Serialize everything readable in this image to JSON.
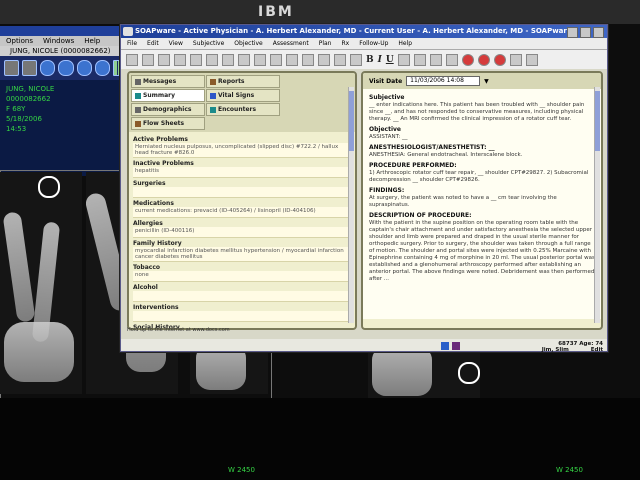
{
  "monitor": {
    "brand": "IBM"
  },
  "viewer": {
    "title": "",
    "menu": [
      "Options",
      "Windows",
      "Help"
    ],
    "patient": "JUNG, NICOLE (0000082662)",
    "meta_lines": [
      "JUNG, NICOLE",
      "0000082662",
      "F 68Y",
      "5/18/2006",
      "14:53"
    ],
    "footer_left": "W 2450",
    "footer_right": "W 2450"
  },
  "app": {
    "title": "SOAPware - Active Physician - A. Herbert Alexander, MD - Current User - A. Herbert Alexander, MD - SOAPware",
    "menu": [
      "File",
      "Edit",
      "View",
      "Subjective",
      "Objective",
      "Assessment",
      "Plan",
      "Rx",
      "Follow-Up",
      "Help"
    ],
    "toolbar_labels": {
      "bold": "B",
      "italic": "I",
      "underline": "U"
    },
    "tabs": [
      {
        "label": "Messages",
        "icon": "envelope-icon"
      },
      {
        "label": "Reports",
        "icon": "report-icon"
      },
      {
        "label": "Summary",
        "icon": "summary-icon"
      },
      {
        "label": "Vital Signs",
        "icon": "vitals-icon"
      },
      {
        "label": "Demographics",
        "icon": "person-icon"
      },
      {
        "label": "Encounters",
        "icon": "encounter-icon"
      },
      {
        "label": "Flow Sheets",
        "icon": "flowsheet-icon"
      }
    ],
    "sections": [
      {
        "title": "Active Problems",
        "body": "Herniated nucleus pulposus, uncomplicated (slipped disc) #722.2 / hallux head fracture #826.0"
      },
      {
        "title": "Inactive Problems",
        "body": "hepatitis"
      },
      {
        "title": "Surgeries",
        "body": ""
      },
      {
        "title": "Medications",
        "body": "current medications: prevacid (ID-405264) / lisinopril (ID-404106)"
      },
      {
        "title": "Allergies",
        "body": "penicillin (ID-400116)"
      },
      {
        "title": "Family History",
        "body": "myocardial infarction diabetes mellitus hypertension / myocardial infarction cancer diabetes mellitus"
      },
      {
        "title": "Tobacco",
        "body": "none"
      },
      {
        "title": "Alcohol",
        "body": ""
      },
      {
        "title": "Interventions",
        "body": ""
      },
      {
        "title": "Social History",
        "body": "married, stock broker"
      },
      {
        "title": "",
        "body": "ROS"
      }
    ],
    "status_left": "Hold up to the Internet at www.docs.com",
    "visit_label": "Visit Date",
    "visit_value": "11/03/2006 14:08",
    "note": [
      {
        "h": "Subjective",
        "p": "__ enter indications here. This patient has been troubled with __ shoulder pain since __, and has not responded to conservative measures, including physical therapy. __ An MRI confirmed the clinical impression of a rotator cuff tear."
      },
      {
        "h": "Objective",
        "p": "ASSISTANT: __"
      },
      {
        "h": "ANESTHESIOLOGIST/ANESTHETIST: __",
        "p": "ANESTHESIA: General endotracheal. Interscalene block."
      },
      {
        "h": "PROCEDURE PERFORMED:",
        "p": "1) Arthroscopic rotator cuff tear repair, __ shoulder CPT#29827. 2) Subacromial decompression __ shoulder CPT#29826."
      },
      {
        "h": "FINDINGS:",
        "p": "At surgery, the patient was noted to have a __ cm tear involving the supraspinatus."
      },
      {
        "h": "DESCRIPTION OF PROCEDURE:",
        "p": "With the patient in the supine position on the operating room table with the captain's chair attachment and under satisfactory anesthesia the selected upper shoulder and limb were prepared and draped in the usual sterile manner for orthopedic surgery. Prior to surgery, the shoulder was taken through a full range of motion. The shoulder and portal sites were injected with 0.25% Marcaine with Epinephrine containing 4 mg of morphine in 20 ml. The usual posterior portal was established and a glenohumeral arthroscopy performed after establishing an anterior portal. The above findings were noted. Debridement was then performed after ..."
      }
    ],
    "patient_info": {
      "id": "68737",
      "age": "Age: 74",
      "name": "Jim, Slim"
    },
    "mode": "Edit"
  }
}
